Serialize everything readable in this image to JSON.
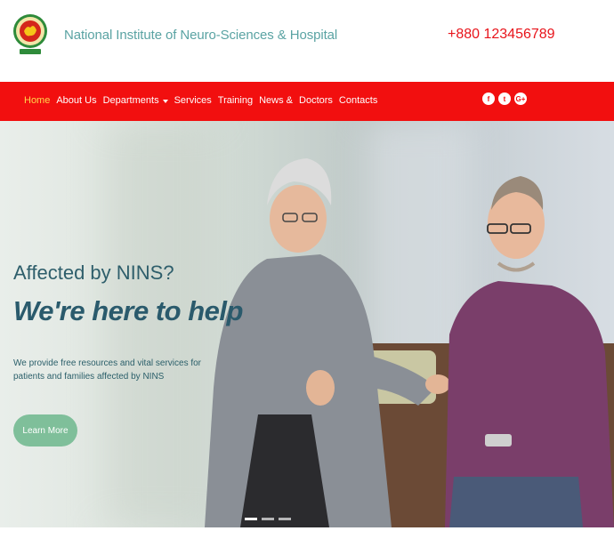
{
  "header": {
    "site_title": "National Institute of Neuro-Sciences & Hospital",
    "phone": "+880 123456789",
    "logo_icon": "institute-logo-icon"
  },
  "nav": {
    "items": [
      {
        "label": "Home",
        "active": true
      },
      {
        "label": "About Us"
      },
      {
        "label": "Departments",
        "dropdown": true
      },
      {
        "label": "Services"
      },
      {
        "label": "Training"
      },
      {
        "label": "News &"
      },
      {
        "label": "Doctors"
      },
      {
        "label": "Contacts"
      }
    ],
    "social": [
      {
        "icon": "facebook-icon",
        "glyph": "f"
      },
      {
        "icon": "twitter-icon",
        "glyph": "t"
      },
      {
        "icon": "google-plus-icon",
        "glyph": "G+"
      }
    ],
    "background": "#f20f0f"
  },
  "hero": {
    "subtitle": "Affected by NINS?",
    "title": "We're here to help",
    "description": "We provide free resources and vital services for patients and families affected by NINS",
    "button_label": "Learn More",
    "slides": 3,
    "active_slide": 1
  }
}
